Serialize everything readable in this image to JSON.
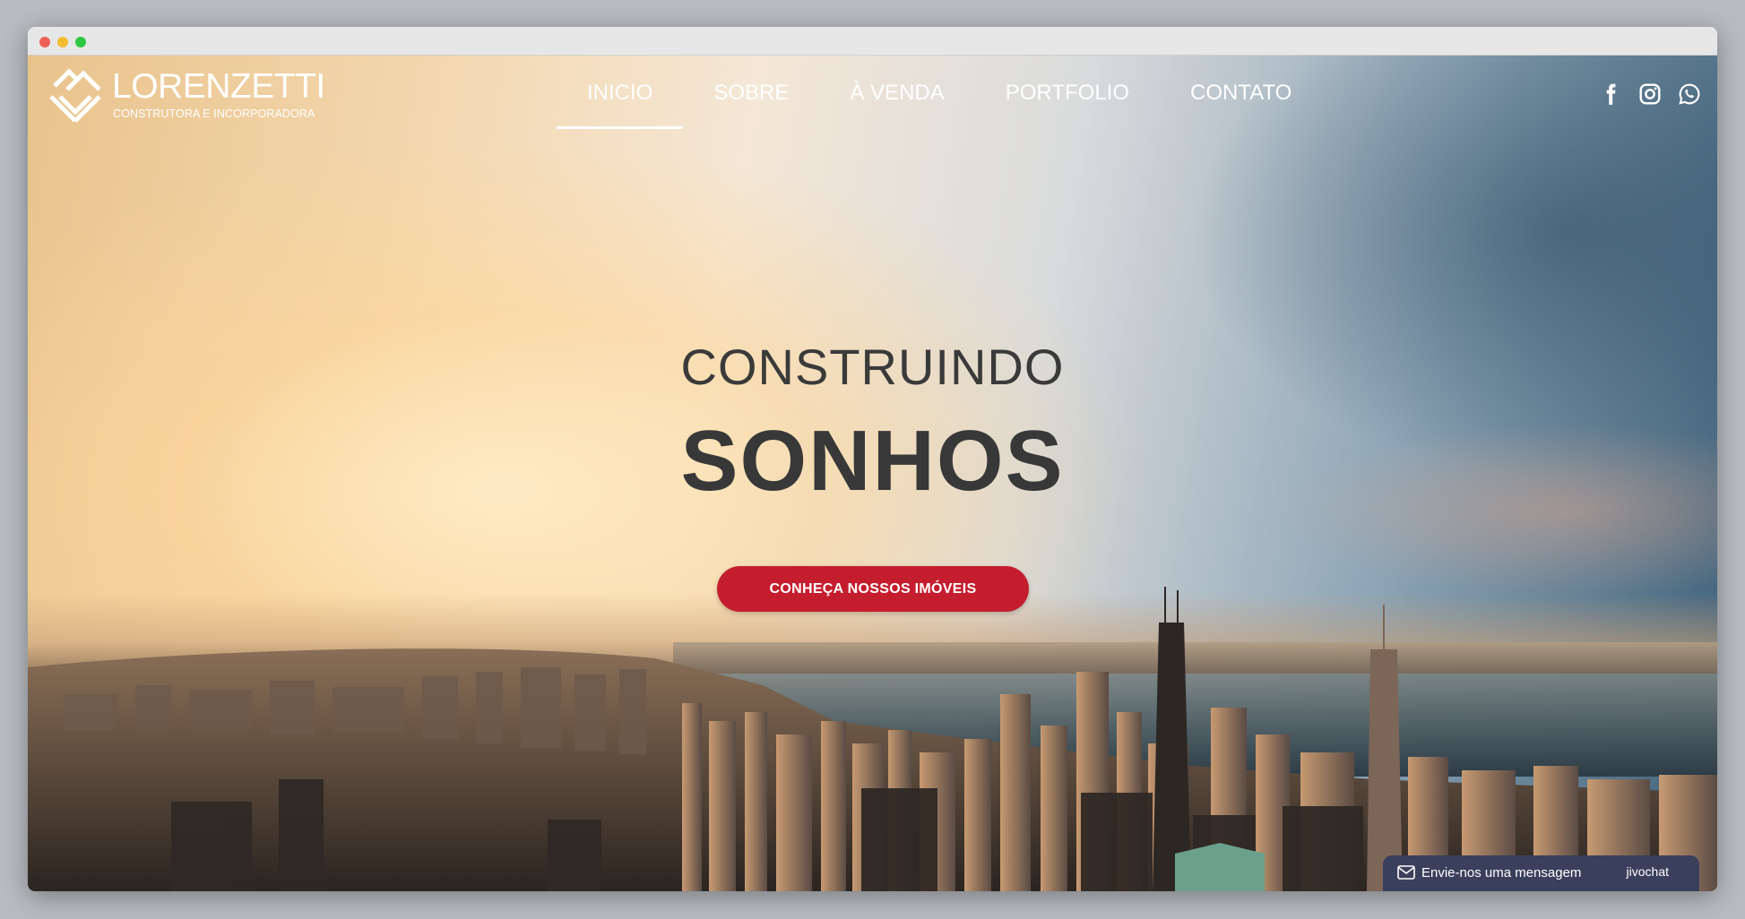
{
  "brand": {
    "name": "LORENZETTI",
    "tagline": "CONSTRUTORA E INCORPORADORA"
  },
  "nav": {
    "items": [
      {
        "label": "INICIO",
        "active": true
      },
      {
        "label": "SOBRE",
        "active": false
      },
      {
        "label": "À VENDA",
        "active": false
      },
      {
        "label": "PORTFOLIO",
        "active": false
      },
      {
        "label": "CONTATO",
        "active": false
      }
    ]
  },
  "socials": {
    "icons": [
      "facebook-icon",
      "instagram-icon",
      "whatsapp-icon"
    ]
  },
  "hero": {
    "line1": "CONSTRUINDO",
    "line2": "SONHOS",
    "cta_label": "CONHEÇA NOSSOS IMÓVEIS"
  },
  "chat": {
    "label": "Envie-nos uma mensagem",
    "brand": "jivochat"
  },
  "colors": {
    "cta": "#c41e2e",
    "chat_bg": "#3a3f5c",
    "hero_text": "#383838"
  }
}
